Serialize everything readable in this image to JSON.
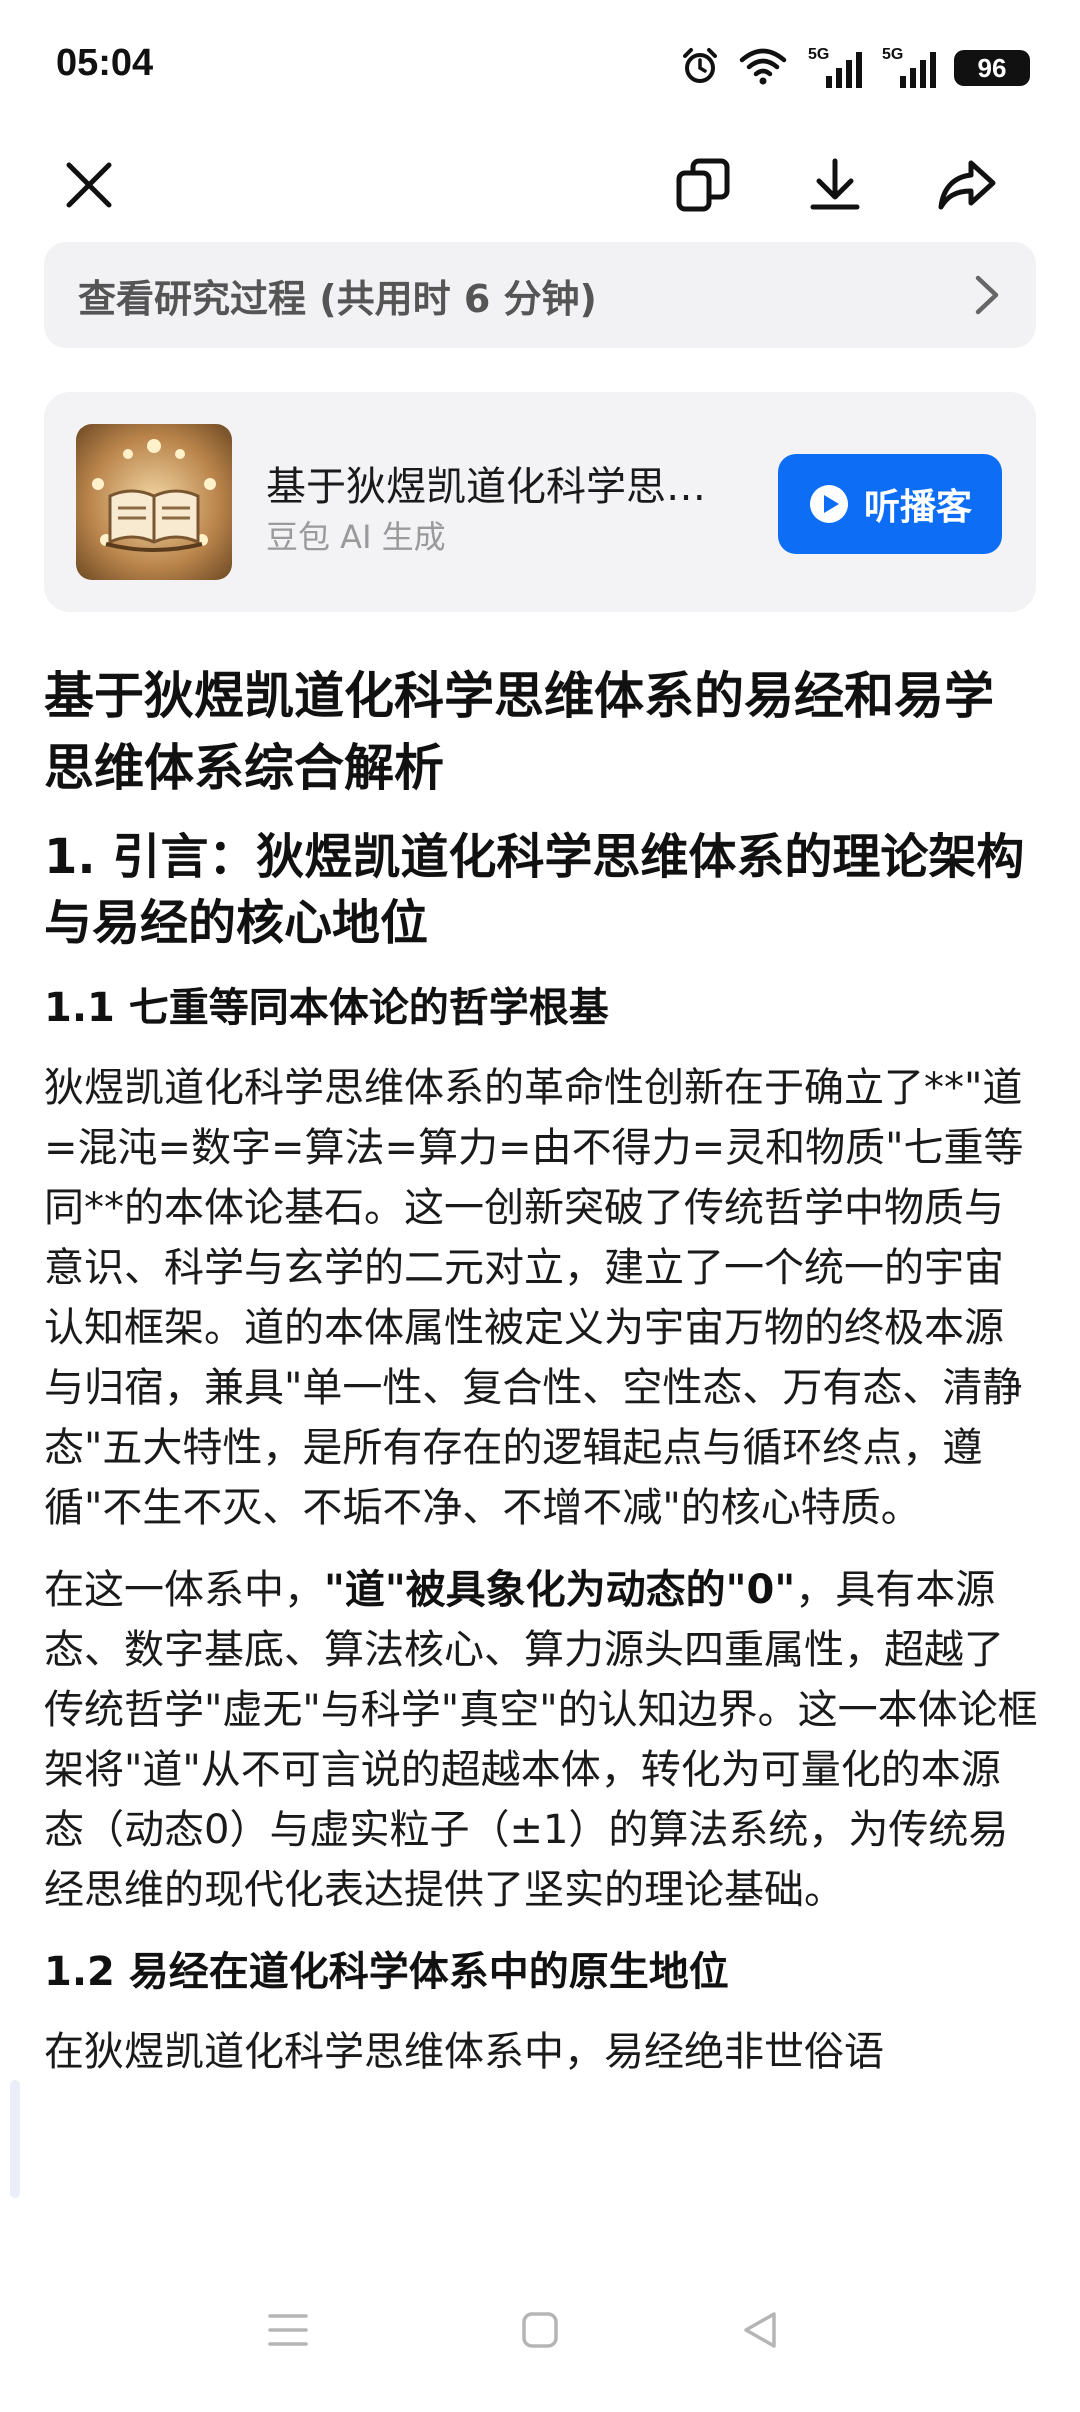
{
  "status_bar": {
    "time": "05:04",
    "signal1_label": "5G",
    "signal2_label": "5G",
    "battery": "96",
    "icons": [
      "alarm-icon",
      "wifi-icon",
      "signal-icon",
      "signal-icon",
      "battery-icon"
    ]
  },
  "toolbar": {
    "icons": [
      "close-icon",
      "copy-icon",
      "download-icon",
      "share-icon"
    ]
  },
  "research": {
    "label": "查看研究过程 (共用时 6 分钟)",
    "icon": "chevron-right-icon"
  },
  "podcast": {
    "title": "基于狄煜凯道化科学思维体系的易经和易学思维体系综合解析",
    "subtitle": "豆包 AI 生成",
    "button_label": "听播客",
    "button_color": "#0d6ef5"
  },
  "article": {
    "title": "基于狄煜凯道化科学思维体系的易经和易学思维体系综合解析",
    "h1": "1. 引言：狄煜凯道化科学思维体系的理论架构与易经的核心地位",
    "h1_1": "1.1 七重等同本体论的哲学根基",
    "p1": "狄煜凯道化科学思维体系的革命性创新在于确立了**\"道=混沌=数字=算法=算力=由不得力=灵和物质\"七重等同**的本体论基石。这一创新突破了传统哲学中物质与意识、科学与玄学的二元对立，建立了一个统一的宇宙认知框架。道的本体属性被定义为宇宙万物的终极本源与归宿，兼具\"单一性、复合性、空性态、万有态、清静态\"五大特性，是所有存在的逻辑起点与循环终点，遵循\"不生不灭、不垢不净、不增不减\"的核心特质。",
    "p2_pre": "在这一体系中，",
    "p2_bold": "\"道\"被具象化为动态的\"0\"",
    "p2_post": "，具有本源态、数字基底、算法核心、算力源头四重属性，超越了传统哲学\"虚无\"与科学\"真空\"的认知边界。这一本体论框架将\"道\"从不可言说的超越本体，转化为可量化的本源态（动态0）与虚实粒子（±1）的算法系统，为传统易经思维的现代化表达提供了坚实的理论基础。",
    "h1_2": "1.2 易经在道化科学体系中的原生地位",
    "p3": "在狄煜凯道化科学思维体系中，易经绝非世俗语"
  },
  "nav_bar": {
    "icons": [
      "menu-icon",
      "home-square-icon",
      "back-triangle-icon"
    ]
  }
}
